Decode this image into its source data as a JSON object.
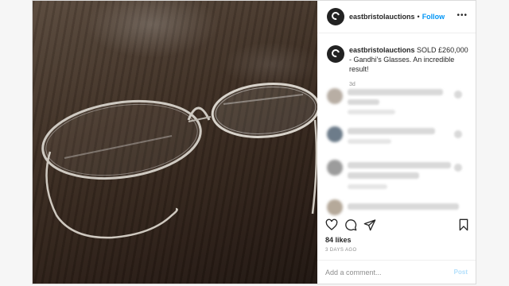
{
  "post": {
    "username": "eastbristolauctions",
    "separator": "•",
    "follow_label": "Follow",
    "more_label": "•••",
    "caption_text": "SOLD £260,000 - Gandhi's Glasses. An incredible result!",
    "caption_time": "3d",
    "likes": "84 likes",
    "time_ago": "3 DAYS AGO",
    "comment_placeholder": "Add a comment...",
    "post_label": "Post"
  },
  "icons": {
    "like": "heart-icon",
    "comment": "comment-icon",
    "share": "share-icon",
    "save": "bookmark-icon",
    "more": "more-icon"
  },
  "colors": {
    "follow": "#0095f6",
    "post_disabled": "#b2dffc",
    "text": "#262626",
    "muted": "#8e8e8e"
  }
}
